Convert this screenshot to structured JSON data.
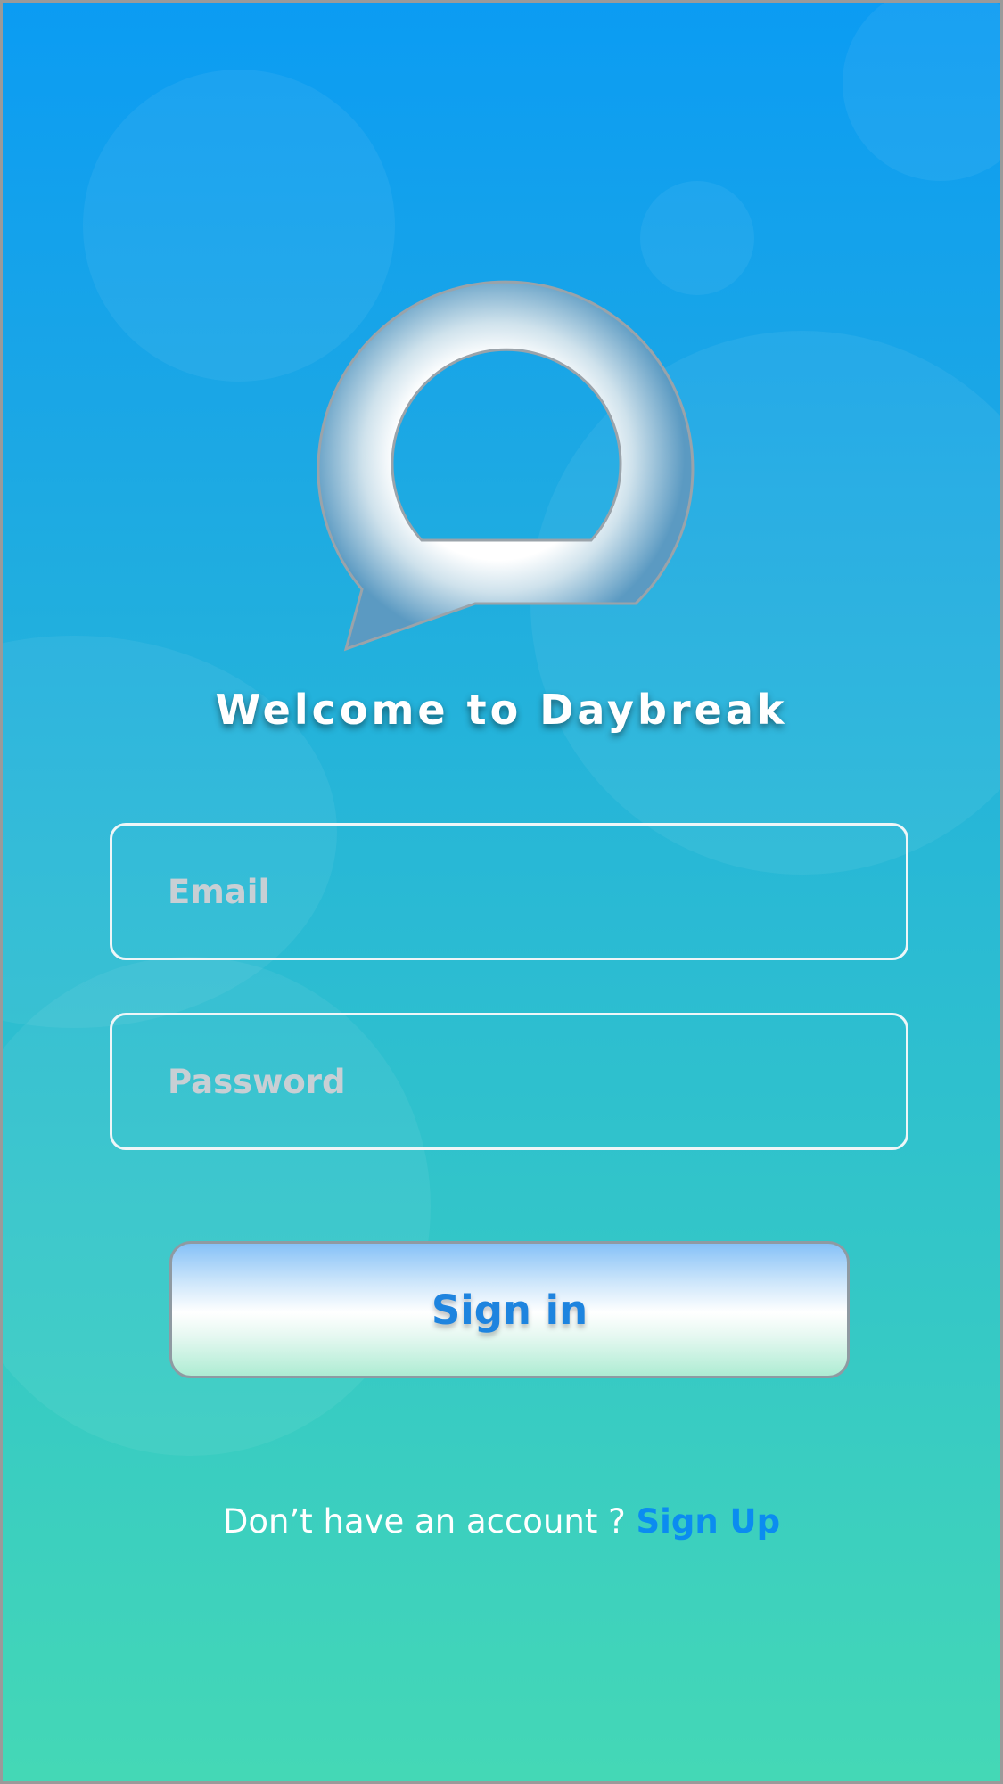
{
  "app": {
    "welcome_title": "Welcome to Daybreak",
    "logo_icon": "chat-bubble-ring-logo"
  },
  "form": {
    "email_placeholder": "Email",
    "email_value": "",
    "password_placeholder": "Password",
    "password_value": "",
    "signin_label": "Sign in"
  },
  "footer": {
    "prompt_text": "Don’t have an account ?",
    "signup_label": "Sign Up"
  },
  "colors": {
    "gradient_top": "#0b9cf3",
    "gradient_bottom": "#44d8b6",
    "link": "#0b8cf0",
    "signin_text": "#1e84df",
    "field_border": "#eef6f8"
  }
}
